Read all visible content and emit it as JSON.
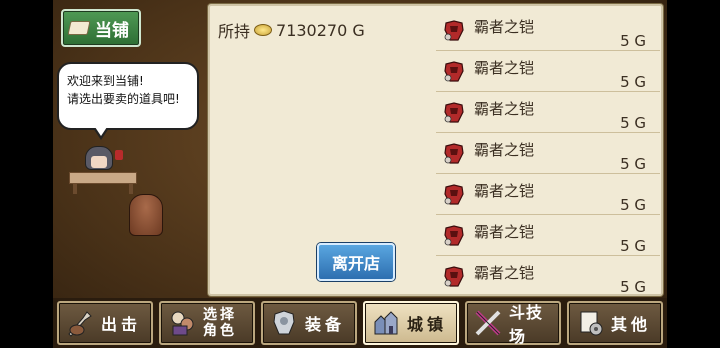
{
  "shop": {
    "title_label": "当铺",
    "greeting_line1": "欢迎来到当铺!",
    "greeting_line2": "请选出要卖的道具吧!"
  },
  "wallet": {
    "label": "所持",
    "amount": "7130270 G"
  },
  "items": [
    {
      "name": "霸者之铠",
      "price": "5 G",
      "icon": "red-armor-icon"
    },
    {
      "name": "霸者之铠",
      "price": "5 G",
      "icon": "red-armor-icon"
    },
    {
      "name": "霸者之铠",
      "price": "5 G",
      "icon": "red-armor-icon"
    },
    {
      "name": "霸者之铠",
      "price": "5 G",
      "icon": "red-armor-icon"
    },
    {
      "name": "霸者之铠",
      "price": "5 G",
      "icon": "red-armor-icon"
    },
    {
      "name": "霸者之铠",
      "price": "5 G",
      "icon": "red-armor-icon"
    },
    {
      "name": "霸者之铠",
      "price": "5 G",
      "icon": "red-armor-icon"
    }
  ],
  "leave_label": "离开店",
  "nav": {
    "sortie": "出击",
    "select_line1": "选择",
    "select_line2": "角色",
    "equip": "装备",
    "town": "城镇",
    "arena": "斗技场",
    "other": "其他"
  },
  "colors": {
    "panel_bg": "#f1ead5",
    "shop_button": "#3f8a45",
    "leave_button": "#3b82c4",
    "item_icon_red": "#b22a2a"
  }
}
